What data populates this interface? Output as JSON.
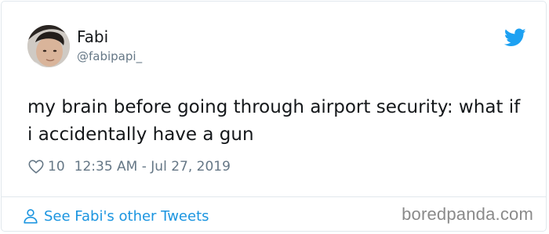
{
  "author": {
    "display_name": "Fabi",
    "handle": "@fabipapi_"
  },
  "icons": {
    "avatar": "avatar-photo",
    "logo": "twitter-bird-icon",
    "like": "heart-outline-icon",
    "profile": "person-outline-icon"
  },
  "tweet": {
    "text": "my brain before going through airport security: what if i accidentally have a gun"
  },
  "meta": {
    "like_count": "10",
    "timestamp": "12:35 AM - Jul 27, 2019"
  },
  "footer": {
    "link_text": "See Fabi's other Tweets",
    "watermark": "boredpanda.com"
  },
  "colors": {
    "twitter_blue": "#1da1f2",
    "link_blue": "#1b95e0",
    "text_primary": "#14171a",
    "text_secondary": "#657786",
    "border": "#e1e8ed"
  }
}
